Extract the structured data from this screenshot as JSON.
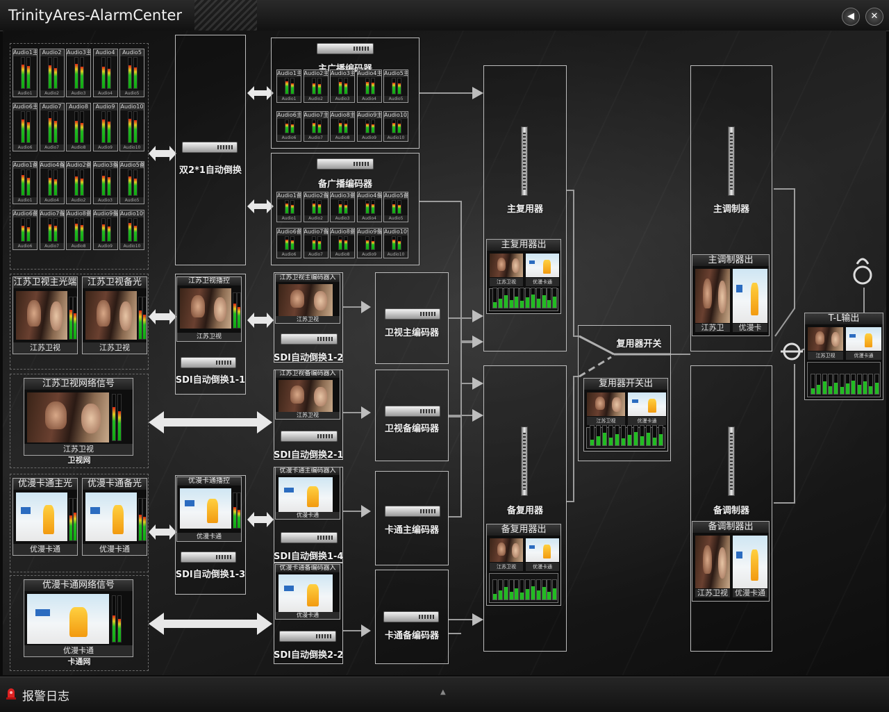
{
  "window": {
    "title": "TrinityAres-AlarmCenter",
    "sound_glyph": "◀",
    "close_glyph": "✕"
  },
  "status_bar": {
    "alarm_log_label": "报警日志",
    "grip_glyph": "▲"
  },
  "audio_rows": [
    [
      {
        "name": "Audio1主",
        "foot": "Audio1"
      },
      {
        "name": "Audio2",
        "foot": "Audio2"
      },
      {
        "name": "Audio3主",
        "foot": "Audio3"
      },
      {
        "name": "Audio4",
        "foot": "Audio4"
      },
      {
        "name": "Audio5",
        "foot": "Audio5"
      }
    ],
    [
      {
        "name": "Audio6主",
        "foot": "Audio6"
      },
      {
        "name": "Audio7",
        "foot": "Audio7"
      },
      {
        "name": "Audio8",
        "foot": "Audio8"
      },
      {
        "name": "Audio9",
        "foot": "Audio9"
      },
      {
        "name": "Audio10",
        "foot": "Audio10"
      }
    ],
    [
      {
        "name": "Audio1备",
        "foot": "Audio1"
      },
      {
        "name": "Audio4备",
        "foot": "Audio4"
      },
      {
        "name": "Audio2备",
        "foot": "Audio2"
      },
      {
        "name": "Audio3备",
        "foot": "Audio3"
      },
      {
        "name": "Audio5备",
        "foot": "Audio5"
      }
    ],
    [
      {
        "name": "Audio6备",
        "foot": "Audio6"
      },
      {
        "name": "Audio7备",
        "foot": "Audio7"
      },
      {
        "name": "Audio8备",
        "foot": "Audio8"
      },
      {
        "name": "Audio9备",
        "foot": "Audio9"
      },
      {
        "name": "Audio10备",
        "foot": "Audio10"
      }
    ]
  ],
  "encoder_audio_rows": [
    [
      {
        "name": "Audio1主编入",
        "foot": "Audio1"
      },
      {
        "name": "Audio2主编入",
        "foot": "Audio2"
      },
      {
        "name": "Audio3主编入",
        "foot": "Audio3"
      },
      {
        "name": "Audio4主编入",
        "foot": "Audio4"
      },
      {
        "name": "Audio5主编入",
        "foot": "Audio5"
      }
    ],
    [
      {
        "name": "Audio6主编入",
        "foot": "Audio6"
      },
      {
        "name": "Audio7主编入",
        "foot": "Audio7"
      },
      {
        "name": "Audio8主编入",
        "foot": "Audio8"
      },
      {
        "name": "Audio9主编入",
        "foot": "Audio9"
      },
      {
        "name": "Audio10主编入",
        "foot": "Audio10"
      }
    ],
    [
      {
        "name": "Audio1备编入",
        "foot": "Audio1"
      },
      {
        "name": "Audio2备编入",
        "foot": "Audio2"
      },
      {
        "name": "Audio3备编入",
        "foot": "Audio3"
      },
      {
        "name": "Audio4备编入",
        "foot": "Audio4"
      },
      {
        "name": "Audio5备编入",
        "foot": "Audio5"
      }
    ],
    [
      {
        "name": "Audio6备编入",
        "foot": "Audio6"
      },
      {
        "name": "Audio7备编入",
        "foot": "Audio7"
      },
      {
        "name": "Audio8备编入",
        "foot": "Audio8"
      },
      {
        "name": "Audio9备编入",
        "foot": "Audio9"
      },
      {
        "name": "Audio10备编入",
        "foot": "Audio10"
      }
    ]
  ],
  "labels": {
    "dual_switch": "双2*1自动倒换",
    "main_broadcast_encoder": "主广播编码器",
    "backup_broadcast_encoder": "备广播编码器",
    "main_mux": "主复用器",
    "backup_mux": "备复用器",
    "main_mux_out": "主复用器出",
    "backup_mux_out": "备复用器出",
    "main_modulator": "主调制器",
    "backup_modulator": "备调制器",
    "main_modulator_out": "主调制器出",
    "backup_modulator_out": "备调制器出",
    "mux_switch": "复用器开关",
    "mux_switch_out": "复用器开关出",
    "tl_output": "T-L输出",
    "ws_main_encoder": "卫视主编码器",
    "ws_backup_encoder": "卫视备编码器",
    "kt_main_encoder": "卡通主编码器",
    "kt_backup_encoder": "卡通备编码器",
    "sdi_1_2": "SDI自动倒换1-2",
    "sdi_1_1": "SDI自动倒换1-1",
    "sdi_2_1": "SDI自动倒换2-1",
    "sdi_1_4": "SDI自动倒换1-4",
    "sdi_1_3": "SDI自动倒换1-3",
    "sdi_2_2": "SDI自动倒换2-2",
    "ws_net_sub": "卫视网",
    "kt_net_sub": "卡通网"
  },
  "monitors": {
    "js_main_light": {
      "title": "江苏卫视主光端",
      "caption": "江苏卫视"
    },
    "js_backup_light": {
      "title": "江苏卫视备光",
      "caption": "江苏卫视"
    },
    "js_playout": {
      "title": "江苏卫视播控",
      "caption": "江苏卫视"
    },
    "js_main_enc_in": {
      "title": "江苏卫视主编码器入",
      "caption": "江苏卫视"
    },
    "js_backup_enc_in": {
      "title": "江苏卫视备编码器入",
      "caption": "江苏卫视"
    },
    "js_network": {
      "title": "江苏卫视网络信号",
      "caption": "江苏卫视"
    },
    "yk_main_light": {
      "title": "优漫卡通主光",
      "caption": "优漫卡通"
    },
    "yk_backup_light": {
      "title": "优漫卡通备光",
      "caption": "优漫卡通"
    },
    "yk_playout": {
      "title": "优漫卡通播控",
      "caption": "优漫卡通"
    },
    "yk_main_enc_in": {
      "title": "优漫卡通主编码器入",
      "caption": "优漫卡通"
    },
    "yk_backup_enc_in": {
      "title": "优漫卡通备编码器入",
      "caption": "优漫卡通"
    },
    "yk_network": {
      "title": "优漫卡通网络信号",
      "caption": "优漫卡通"
    }
  },
  "dual_monitors": {
    "main_mux_out": {
      "left": "江苏卫视",
      "right": "优漫卡通"
    },
    "backup_mux_out": {
      "left": "江苏卫视",
      "right": "优漫卡通"
    },
    "mux_switch_out": {
      "left": "江苏卫视",
      "right": "优漫卡通"
    },
    "tl_out": {
      "left": "江苏卫视",
      "right": "优漫卡通"
    },
    "main_mod_out": {
      "left": "江苏卫",
      "right": "优漫卡"
    },
    "backup_mod_out": {
      "left": "江苏卫视",
      "right": "优漫卡通"
    }
  }
}
